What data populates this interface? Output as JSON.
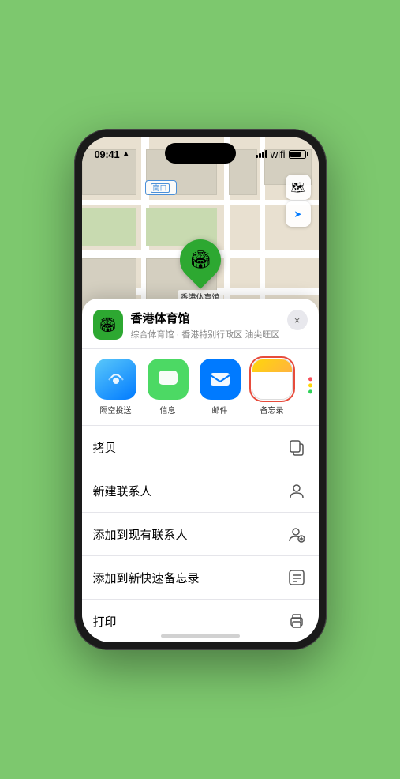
{
  "status_bar": {
    "time": "09:41",
    "location_arrow": "▲"
  },
  "map": {
    "location_label": "南口",
    "pin_emoji": "🏟",
    "venue_name_pin": "香港体育馆",
    "controls": {
      "map_icon": "🗺",
      "location_icon": "➤"
    }
  },
  "bottom_sheet": {
    "venue": {
      "icon_emoji": "🏟",
      "name": "香港体育馆",
      "description": "综合体育馆 · 香港特别行政区 油尖旺区",
      "close_label": "×"
    },
    "share_items": [
      {
        "label": "隔空投送",
        "type": "airdrop"
      },
      {
        "label": "信息",
        "type": "message"
      },
      {
        "label": "邮件",
        "type": "mail"
      },
      {
        "label": "备忘录",
        "type": "notes",
        "selected": true
      }
    ],
    "more_dots_colors": [
      "#f74f5a",
      "#ffd60a",
      "#30d158"
    ],
    "actions": [
      {
        "label": "拷贝",
        "icon": "📋"
      },
      {
        "label": "新建联系人",
        "icon": "👤"
      },
      {
        "label": "添加到现有联系人",
        "icon": "👤"
      },
      {
        "label": "添加到新快速备忘录",
        "icon": "⊞"
      },
      {
        "label": "打印",
        "icon": "🖨"
      }
    ]
  }
}
